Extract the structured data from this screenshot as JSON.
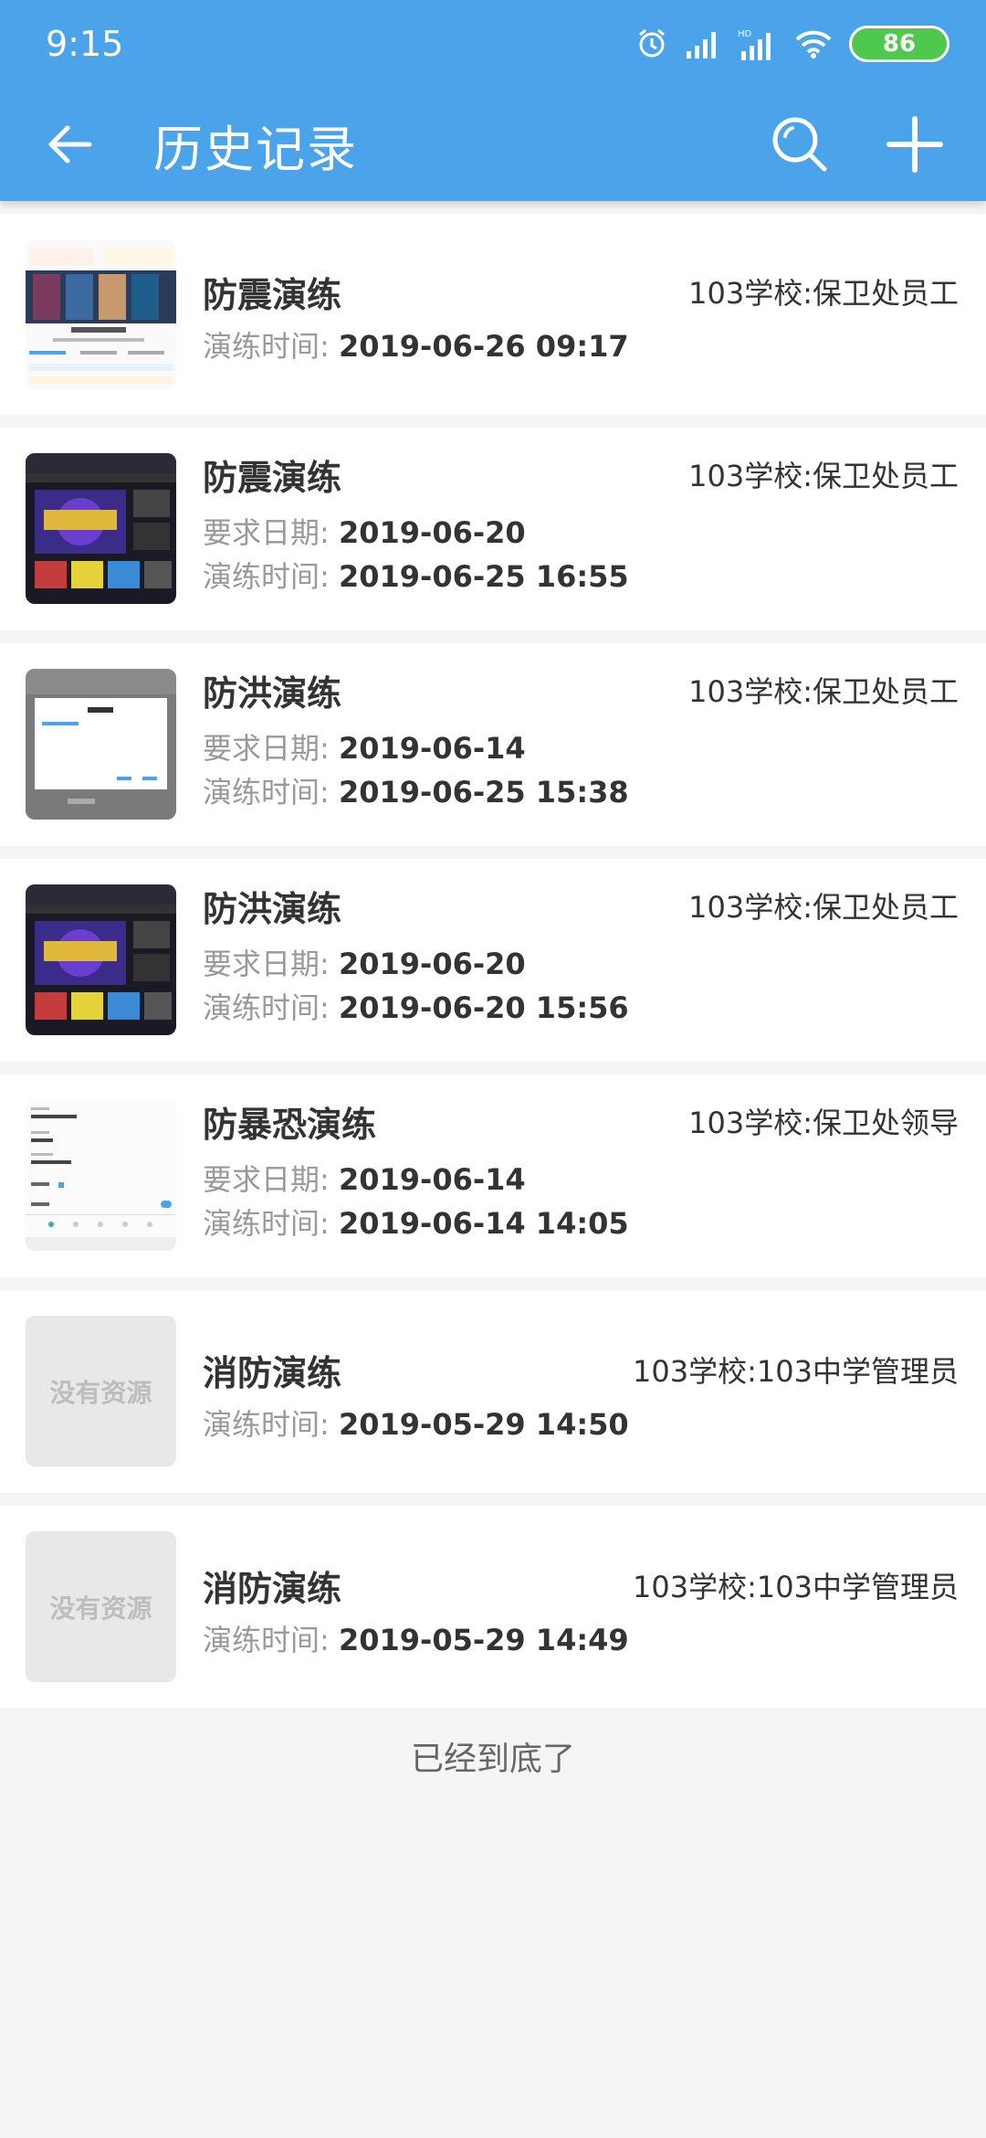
{
  "status_bar": {
    "time": "9:15",
    "battery": "86",
    "icons": [
      "alarm-icon",
      "signal-icon",
      "hd-signal-icon",
      "wifi-icon",
      "battery-icon"
    ]
  },
  "app_bar": {
    "title": "历史记录",
    "back_icon": "arrow-left-icon",
    "search_icon": "search-icon",
    "add_icon": "plus-icon"
  },
  "labels": {
    "required_date": "要求日期:",
    "drill_time": "演练时间:",
    "no_resource": "没有资源"
  },
  "items": [
    {
      "title": "防震演练",
      "org": "103学校:保卫处员工",
      "required_date": "",
      "drill_time": "2019-06-26 09:17",
      "thumb": "app-screenshot-movies"
    },
    {
      "title": "防震演练",
      "org": "103学校:保卫处员工",
      "required_date": "2019-06-20",
      "drill_time": "2019-06-25 16:55",
      "thumb": "game-poster"
    },
    {
      "title": "防洪演练",
      "org": "103学校:保卫处员工",
      "required_date": "2019-06-14",
      "drill_time": "2019-06-25 15:38",
      "thumb": "dialog-screenshot"
    },
    {
      "title": "防洪演练",
      "org": "103学校:保卫处员工",
      "required_date": "2019-06-20",
      "drill_time": "2019-06-20 15:56",
      "thumb": "game-poster"
    },
    {
      "title": "防暴恐演练",
      "org": "103学校:保卫处领导",
      "required_date": "2019-06-14",
      "drill_time": "2019-06-14 14:05",
      "thumb": "form-screenshot"
    },
    {
      "title": "消防演练",
      "org": "103学校:103中学管理员",
      "required_date": "",
      "drill_time": "2019-05-29 14:50",
      "thumb": "no-resource"
    },
    {
      "title": "消防演练",
      "org": "103学校:103中学管理员",
      "required_date": "",
      "drill_time": "2019-05-29 14:49",
      "thumb": "no-resource"
    }
  ],
  "footer": "已经到底了",
  "colors": {
    "primary": "#4ba3e9",
    "battery": "#4ec94e",
    "background": "#f5f5f5"
  }
}
